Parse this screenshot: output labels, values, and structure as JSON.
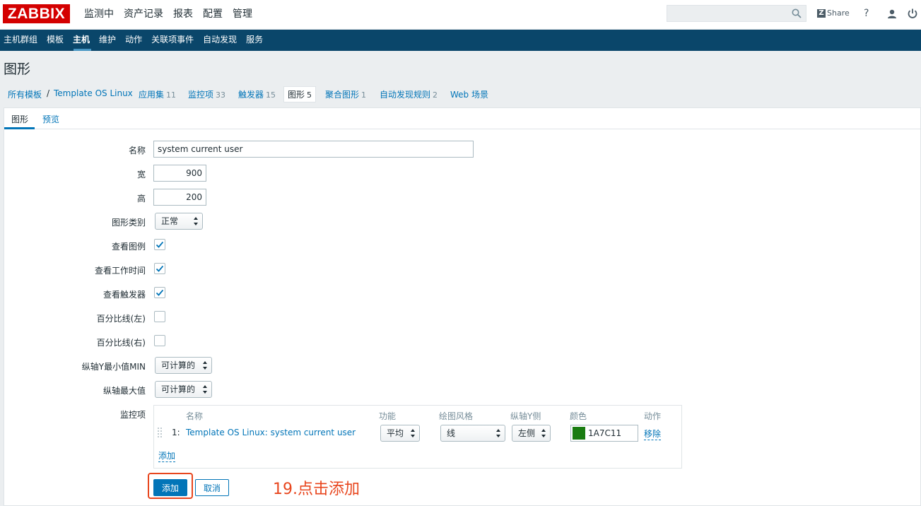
{
  "app": {
    "logo": "ZABBIX"
  },
  "main_menu": [
    "监测中",
    "资产记录",
    "报表",
    "配置",
    "管理"
  ],
  "header": {
    "search_value": "",
    "share_badge": "Z",
    "share_label": "Share",
    "help_label": "?"
  },
  "sub_menu": [
    "主机群组",
    "模板",
    "主机",
    "维护",
    "动作",
    "关联项事件",
    "自动发现",
    "服务"
  ],
  "page_title": "图形",
  "nav": {
    "all_templates": "所有模板",
    "separator": "/",
    "template_name": "Template OS Linux",
    "applications": {
      "label": "应用集",
      "count": "11"
    },
    "items": {
      "label": "监控项",
      "count": "33"
    },
    "triggers": {
      "label": "触发器",
      "count": "15"
    },
    "graphs": {
      "label": "图形",
      "count": "5"
    },
    "screens": {
      "label": "聚合图形",
      "count": "1"
    },
    "discovery": {
      "label": "自动发现规则",
      "count": "2"
    },
    "web": {
      "label": "Web 场景"
    }
  },
  "tabs": {
    "graph": "图形",
    "preview": "预览"
  },
  "form": {
    "name_label": "名称",
    "name_value": "system current user",
    "width_label": "宽",
    "width_value": "900",
    "height_label": "高",
    "height_value": "200",
    "graph_type_label": "图形类别",
    "graph_type_value": "正常",
    "show_legend_label": "查看图例",
    "show_legend": true,
    "show_working_time_label": "查看工作时间",
    "show_working_time": true,
    "show_triggers_label": "查看触发器",
    "show_triggers": true,
    "percentile_left_label": "百分比线(左)",
    "percentile_left": false,
    "percentile_right_label": "百分比线(右)",
    "percentile_right": false,
    "ymin_label": "纵轴Y最小值MIN",
    "ymin_value": "可计算的",
    "ymax_label": "纵轴最大值",
    "ymax_value": "可计算的",
    "items_label": "监控项"
  },
  "items_table": {
    "headers": {
      "name": "名称",
      "function": "功能",
      "draw_style": "绘图风格",
      "y_axis_side": "纵轴Y侧",
      "color": "颜色",
      "action": "动作"
    },
    "rows": [
      {
        "index": "1:",
        "name": "Template OS Linux: system current user",
        "function": "平均",
        "draw_style": "线",
        "y_axis_side": "左侧",
        "color": "1A7C11",
        "color_hex": "#1a7c11",
        "action": "移除"
      }
    ],
    "add_link": "添加"
  },
  "buttons": {
    "add": "添加",
    "cancel": "取消"
  },
  "annotation": {
    "text": "19.点击添加",
    "color": "#e8461e"
  },
  "colors": {
    "accent": "#0275b8",
    "submenu_bg": "#0a466a",
    "logo_bg": "#d40000"
  }
}
